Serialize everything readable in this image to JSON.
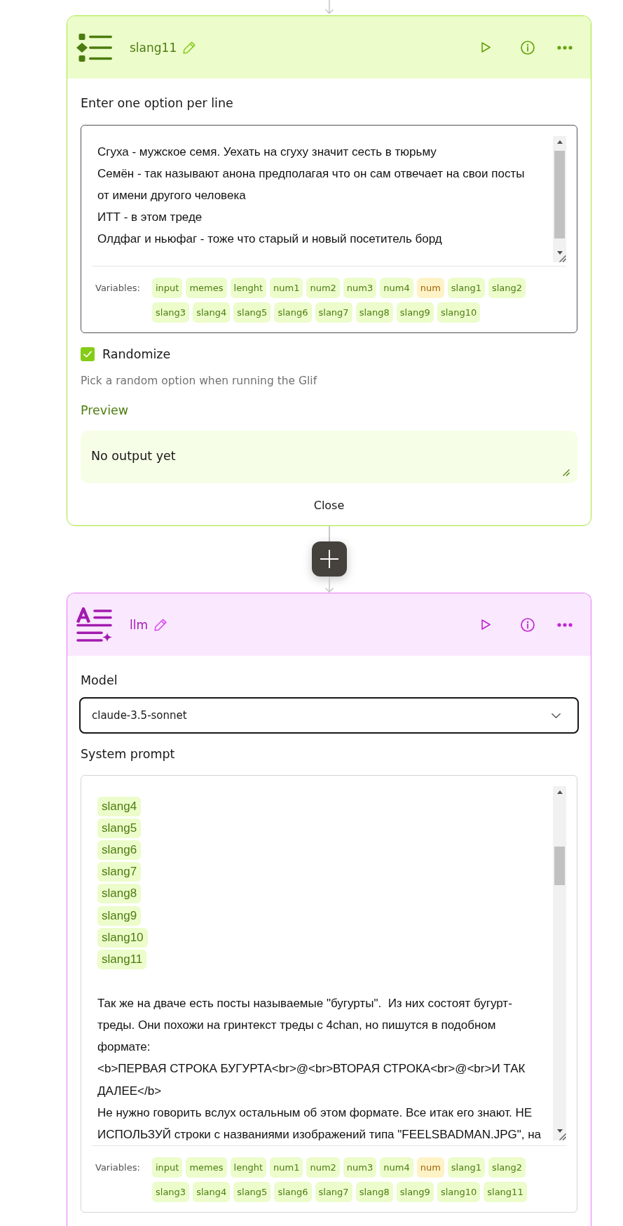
{
  "list_block": {
    "title": "slang11",
    "label": "Enter one option per line",
    "options": [
      "Сгуха - мужское семя. Уехать на сгуху значит сесть в тюрьму",
      "Семён - так называют анона предполагая что он сам отвечает на свои посты от имени другого человека",
      "ИТТ - в этом треде",
      "Олдфаг и ньюфаг - тоже что старый и новый посетитель борд"
    ],
    "variables_label": "Variables:",
    "variables": [
      {
        "name": "input",
        "color": "#ecfccb"
      },
      {
        "name": "memes",
        "color": "#ecfccb"
      },
      {
        "name": "lenght",
        "color": "#ecfccb"
      },
      {
        "name": "num1",
        "color": "#ecfccb"
      },
      {
        "name": "num2",
        "color": "#ecfccb"
      },
      {
        "name": "num3",
        "color": "#ecfccb"
      },
      {
        "name": "num4",
        "color": "#ecfccb"
      },
      {
        "name": "num",
        "color": "#fef3c7"
      },
      {
        "name": "slang1",
        "color": "#ecfccb"
      },
      {
        "name": "slang2",
        "color": "#ecfccb"
      },
      {
        "name": "slang3",
        "color": "#ecfccb"
      },
      {
        "name": "slang4",
        "color": "#ecfccb"
      },
      {
        "name": "slang5",
        "color": "#ecfccb"
      },
      {
        "name": "slang6",
        "color": "#ecfccb"
      },
      {
        "name": "slang7",
        "color": "#ecfccb"
      },
      {
        "name": "slang8",
        "color": "#ecfccb"
      },
      {
        "name": "slang9",
        "color": "#ecfccb"
      },
      {
        "name": "slang10",
        "color": "#ecfccb"
      }
    ],
    "randomize": {
      "label": "Randomize",
      "checked": true
    },
    "hint": "Pick a random option when running the Glif",
    "preview": {
      "heading": "Preview",
      "value": "No output yet"
    },
    "close": "Close"
  },
  "llm_block": {
    "title": "llm",
    "model": {
      "label": "Model",
      "value": "claude-3.5-sonnet"
    },
    "system_prompt": {
      "label": "System prompt",
      "content": [
        {
          "kind": "variable",
          "text": "slang4"
        },
        {
          "kind": "variable",
          "text": "slang5"
        },
        {
          "kind": "variable",
          "text": "slang6"
        },
        {
          "kind": "variable",
          "text": "slang7"
        },
        {
          "kind": "variable",
          "text": "slang8"
        },
        {
          "kind": "variable",
          "text": "slang9"
        },
        {
          "kind": "variable",
          "text": "slang10"
        },
        {
          "kind": "variable",
          "text": "slang11"
        },
        {
          "kind": "blank"
        },
        {
          "kind": "text",
          "text": "Так же на дваче есть посты называемые \"бугурты\".  Из них состоят бугурт-треды. Они похожи на гринтекст треды с 4chan, но пишутся в подобном формате:"
        },
        {
          "kind": "text",
          "text": "<b>ПЕРВАЯ СТРОКА БУГУРТА<br>@<br>ВТОРАЯ СТРОКА<br>@<br>И ТАК ДАЛЕЕ</b>"
        },
        {
          "kind": "text",
          "text": "Не нужно говорить вслух остальным об этом формате. Все итак его знают. НЕ ИСПОЛЬЗУЙ строки с названиями изображений типа \"FEELSBADMAN.JPG\", на"
        }
      ],
      "variables_label": "Variables:",
      "variables": [
        {
          "name": "input",
          "color": "#ecfccb"
        },
        {
          "name": "memes",
          "color": "#ecfccb"
        },
        {
          "name": "lenght",
          "color": "#ecfccb"
        },
        {
          "name": "num1",
          "color": "#ecfccb"
        },
        {
          "name": "num2",
          "color": "#ecfccb"
        },
        {
          "name": "num3",
          "color": "#ecfccb"
        },
        {
          "name": "num4",
          "color": "#ecfccb"
        },
        {
          "name": "num",
          "color": "#fef3c7"
        },
        {
          "name": "slang1",
          "color": "#ecfccb"
        },
        {
          "name": "slang2",
          "color": "#ecfccb"
        },
        {
          "name": "slang3",
          "color": "#ecfccb"
        },
        {
          "name": "slang4",
          "color": "#ecfccb"
        },
        {
          "name": "slang5",
          "color": "#ecfccb"
        },
        {
          "name": "slang6",
          "color": "#ecfccb"
        },
        {
          "name": "slang7",
          "color": "#ecfccb"
        },
        {
          "name": "slang8",
          "color": "#ecfccb"
        },
        {
          "name": "slang9",
          "color": "#ecfccb"
        },
        {
          "name": "slang10",
          "color": "#ecfccb"
        },
        {
          "name": "slang11",
          "color": "#ecfccb"
        }
      ]
    }
  }
}
